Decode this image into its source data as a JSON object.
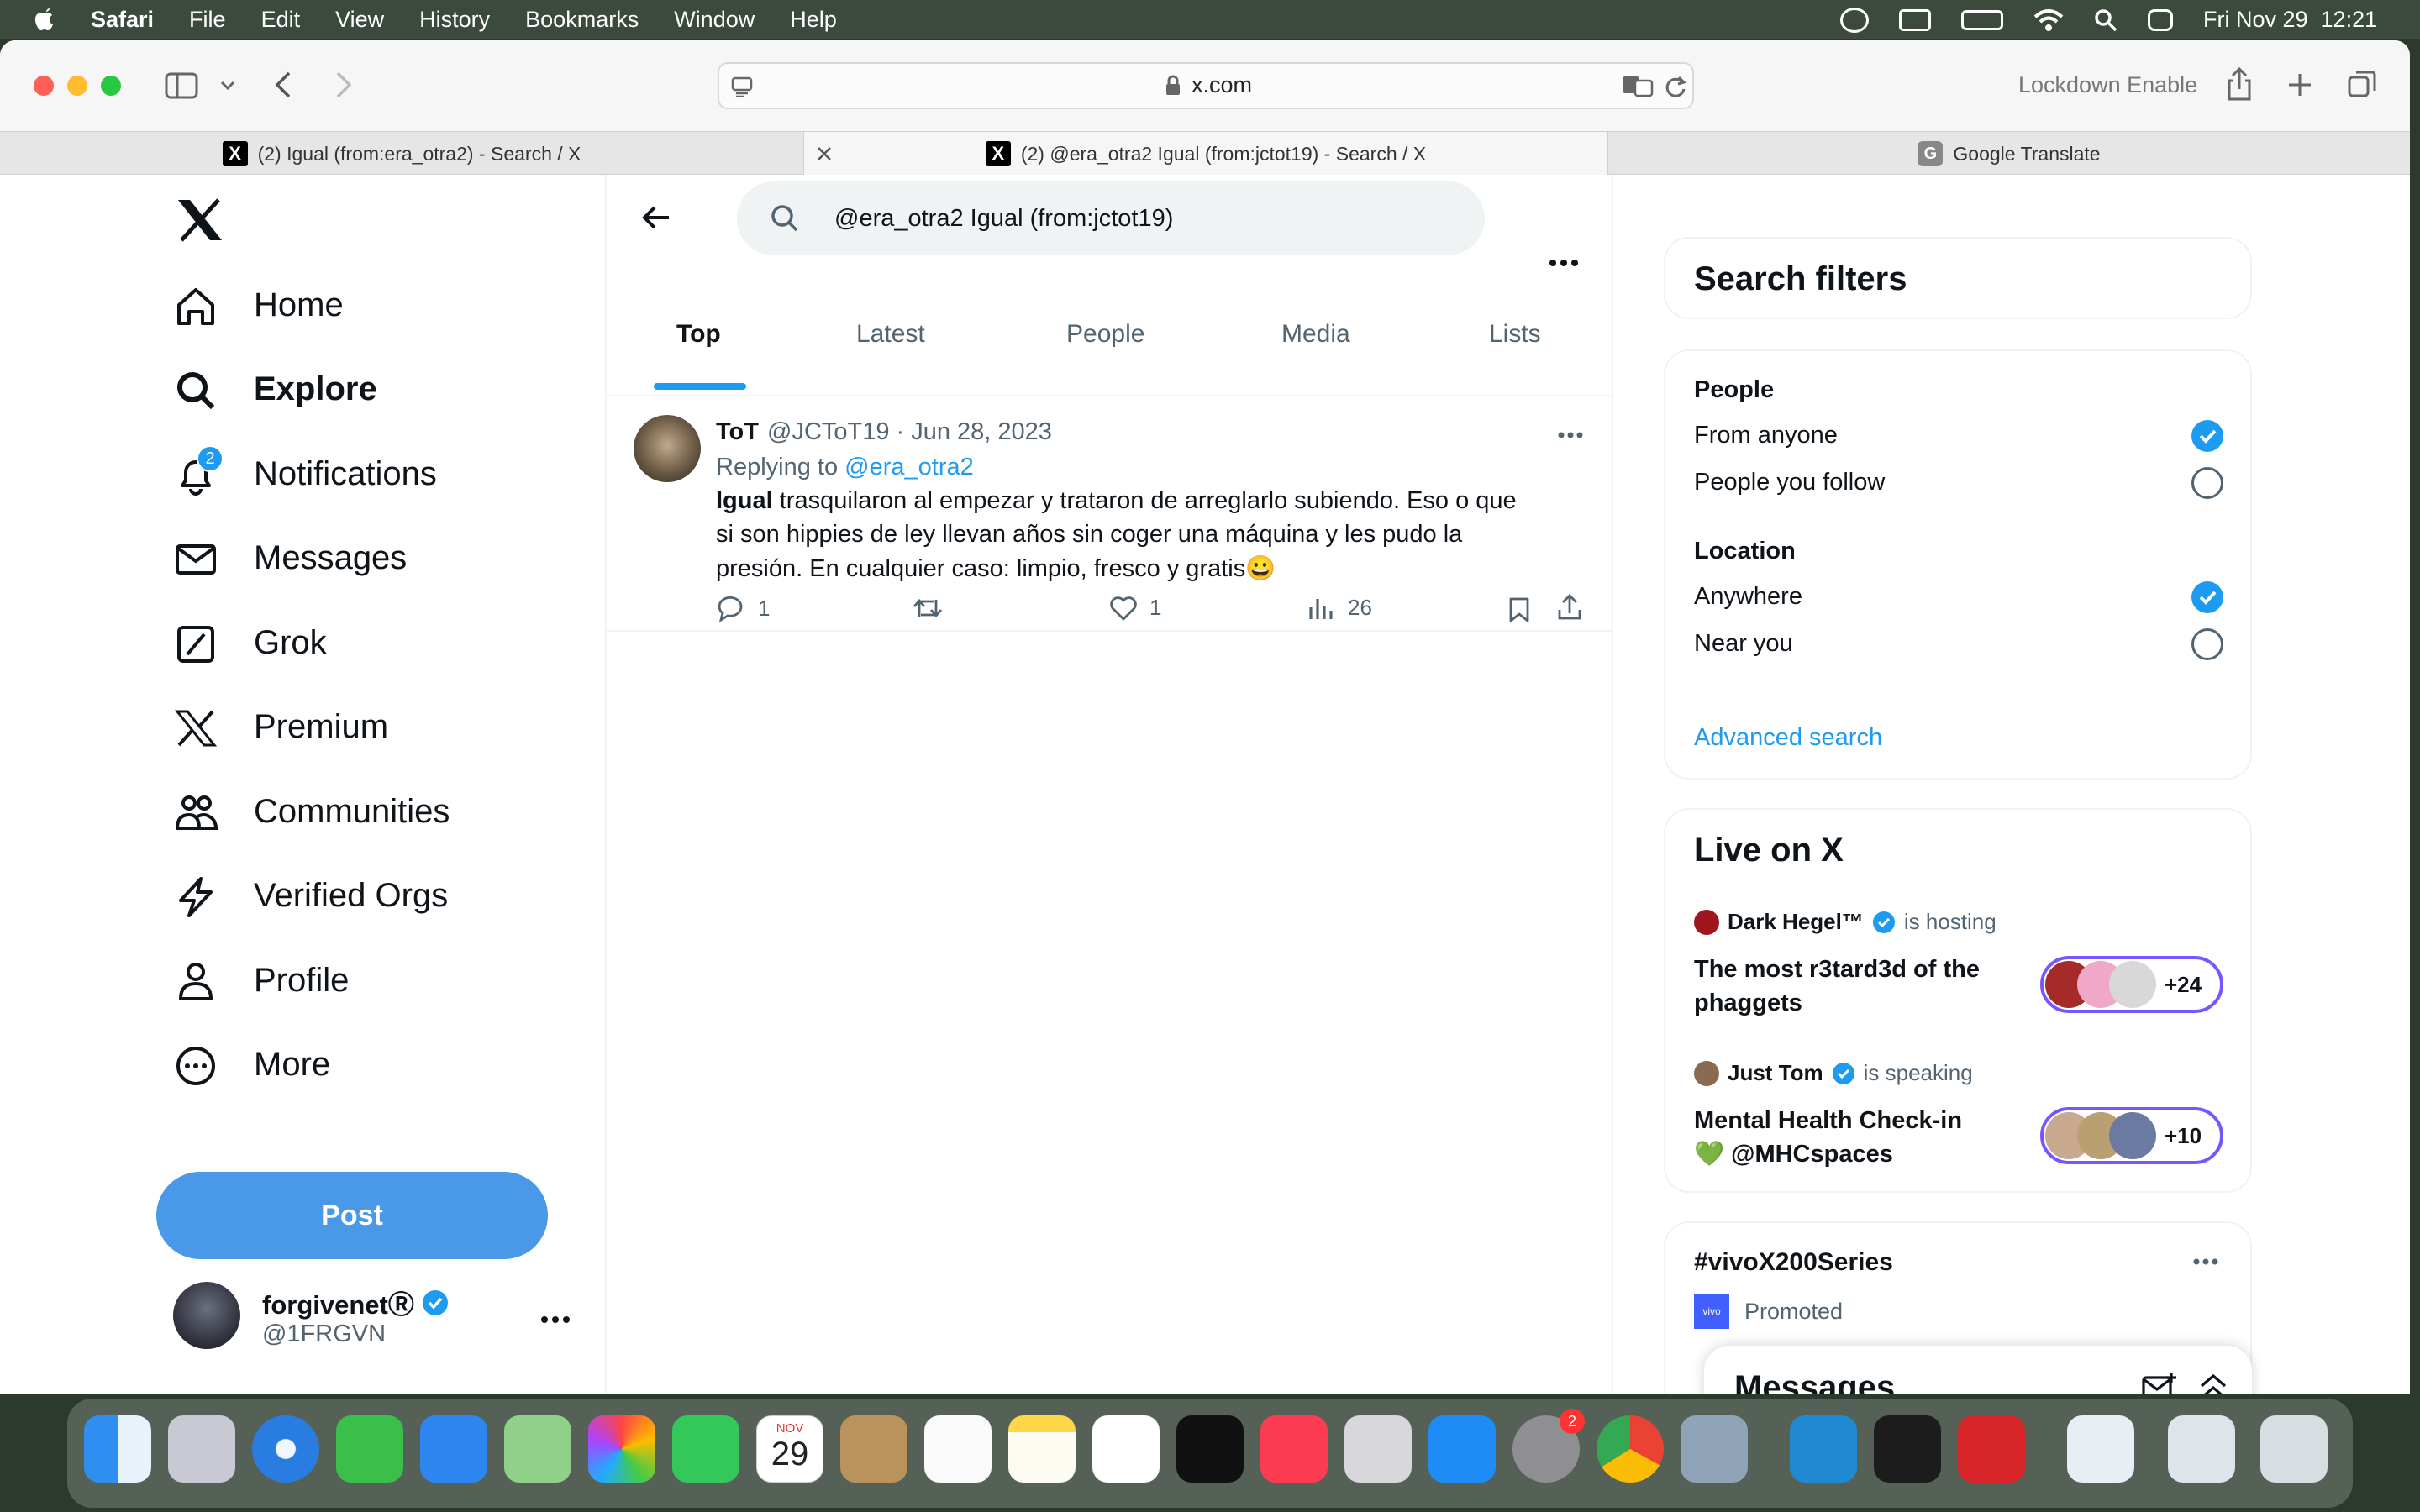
{
  "menubar": {
    "app": "Safari",
    "menus": [
      "File",
      "Edit",
      "View",
      "History",
      "Bookmarks",
      "Window",
      "Help"
    ],
    "datetime": "Fri Nov 29  12:21"
  },
  "browser": {
    "url": "x.com",
    "lockdown": "Lockdown Enable",
    "tabs": [
      {
        "title": "(2) Igual (from:era_otra2) - Search / X"
      },
      {
        "title": "(2) @era_otra2 Igual (from:jctot19) - Search / X"
      },
      {
        "title": "Google Translate"
      }
    ]
  },
  "nav": {
    "items": [
      {
        "label": "Home",
        "icon": "home-icon"
      },
      {
        "label": "Explore",
        "icon": "search-icon"
      },
      {
        "label": "Notifications",
        "icon": "bell-icon"
      },
      {
        "label": "Messages",
        "icon": "mail-icon"
      },
      {
        "label": "Grok",
        "icon": "grok-icon"
      },
      {
        "label": "Premium",
        "icon": "x-logo-icon"
      },
      {
        "label": "Communities",
        "icon": "people-icon"
      },
      {
        "label": "Verified Orgs",
        "icon": "lightning-icon"
      },
      {
        "label": "Profile",
        "icon": "person-icon"
      },
      {
        "label": "More",
        "icon": "more-circle-icon"
      }
    ],
    "notification_count": "2",
    "post_label": "Post",
    "account_name": "forgivenetⓇ",
    "account_handle": "@1FRGVN"
  },
  "search": {
    "query": "@era_otra2 Igual (from:jctot19)",
    "tabs": [
      "Top",
      "Latest",
      "People",
      "Media",
      "Lists"
    ],
    "selected_tab": "Top"
  },
  "tweet": {
    "name": "ToT",
    "handle": "@JCToT19",
    "date": "· Jun 28, 2023",
    "replying_prefix": "Replying to",
    "replying_to": "@era_otra2",
    "text_bold": "Igual",
    "text_1": " trasquilaron al empezar y trataron de arreglarlo subiendo. Eso o que",
    "text_2": "si son hippies de ley llevan años sin coger una máquina y les pudo la",
    "text_3": "presión. En cualquier caso: limpio, fresco y gratis😀",
    "replies": "1",
    "likes": "1",
    "views": "26"
  },
  "filters": {
    "title": "Search filters",
    "people_heading": "People",
    "from_anyone": "From anyone",
    "people_you_follow": "People you follow",
    "location_heading": "Location",
    "anywhere": "Anywhere",
    "near_you": "Near you",
    "advanced": "Advanced search"
  },
  "live": {
    "title": "Live on X",
    "spaces": [
      {
        "host": "Dark Hegel™",
        "status": "is hosting",
        "title_1": "The most r3tard3d of the",
        "title_2": "phaggets",
        "count": "+24"
      },
      {
        "host": "Just Tom",
        "status": "is speaking",
        "title_1": "Mental Health Check-in",
        "title_2": "💚 @MHCspaces",
        "count": "+10"
      }
    ]
  },
  "promo": {
    "hashtag": "#vivoX200Series",
    "promoted": "Promoted",
    "brand": "vivo"
  },
  "messages_drawer": {
    "title": "Messages"
  },
  "dock": {
    "calendar_month": "NOV",
    "calendar_day": "29",
    "settings_badge": "2"
  },
  "colors": {
    "accent": "#1d9bf0",
    "post_button": "#4a99e9",
    "text": "#0f1419",
    "muted": "#536471"
  }
}
